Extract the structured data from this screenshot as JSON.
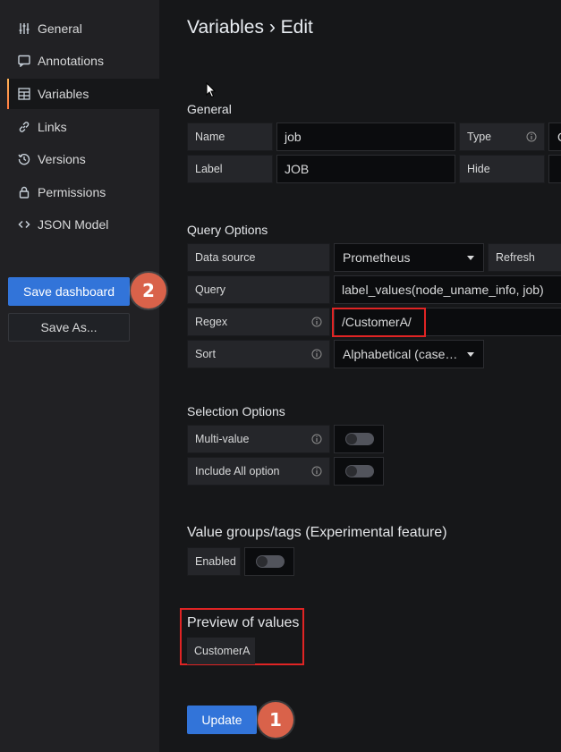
{
  "sidebar": {
    "items": [
      {
        "label": "General",
        "icon": "sliders-icon"
      },
      {
        "label": "Annotations",
        "icon": "comment-icon"
      },
      {
        "label": "Variables",
        "icon": "calculator-icon",
        "active": true
      },
      {
        "label": "Links",
        "icon": "link-icon"
      },
      {
        "label": "Versions",
        "icon": "history-icon"
      },
      {
        "label": "Permissions",
        "icon": "lock-icon"
      },
      {
        "label": "JSON Model",
        "icon": "code-icon"
      }
    ],
    "save_dashboard": "Save dashboard",
    "save_as": "Save As..."
  },
  "badges": {
    "one": "1",
    "two": "2"
  },
  "page": {
    "title": "Variables › Edit"
  },
  "general": {
    "title": "General",
    "name_label": "Name",
    "name_value": "job",
    "type_label": "Type",
    "type_value": "Q",
    "label_label": "Label",
    "label_value": "JOB",
    "hide_label": "Hide"
  },
  "query": {
    "title": "Query Options",
    "datasource_label": "Data source",
    "datasource_value": "Prometheus",
    "refresh_label": "Refresh",
    "query_label": "Query",
    "query_value": "label_values(node_uname_info, job)",
    "regex_label": "Regex",
    "regex_value": "/CustomerA/",
    "sort_label": "Sort",
    "sort_value": "Alphabetical (case…"
  },
  "selection": {
    "title": "Selection Options",
    "multi_label": "Multi-value",
    "multi_on": false,
    "include_all_label": "Include All option",
    "include_all_on": false
  },
  "tags": {
    "title": "Value groups/tags (Experimental feature)",
    "enabled_label": "Enabled",
    "enabled_on": false
  },
  "preview": {
    "title": "Preview of values",
    "values": [
      "CustomerA"
    ]
  },
  "actions": {
    "update": "Update"
  },
  "colors": {
    "primary": "#3274d9",
    "highlight": "#e02424",
    "badge": "#d9624a",
    "active_accent": "#ff7941"
  }
}
